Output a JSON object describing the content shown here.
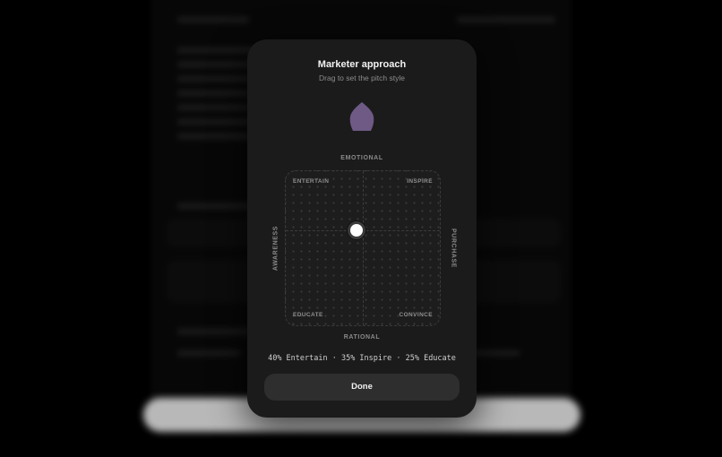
{
  "modal": {
    "title": "Marketer approach",
    "subtitle": "Drag to set the pitch style",
    "axes": {
      "top": "EMOTIONAL",
      "bottom": "RATIONAL",
      "left": "AWARENESS",
      "right": "PURCHASE"
    },
    "corners": {
      "top_left": "ENTERTAIN",
      "top_right": "INSPIRE",
      "bottom_left": "EDUCATE",
      "bottom_right": "CONVINCE"
    },
    "mix_summary": "40% Entertain · 35% Inspire · 25% Educate",
    "done_label": "Done"
  },
  "colors": {
    "modal_bg": "#1b1b1c",
    "shape_fill": "#6e5a84",
    "button_bg": "#2e2e2f",
    "handle": "#ffffff"
  },
  "icons": {
    "shape": "drop-shape-icon"
  }
}
